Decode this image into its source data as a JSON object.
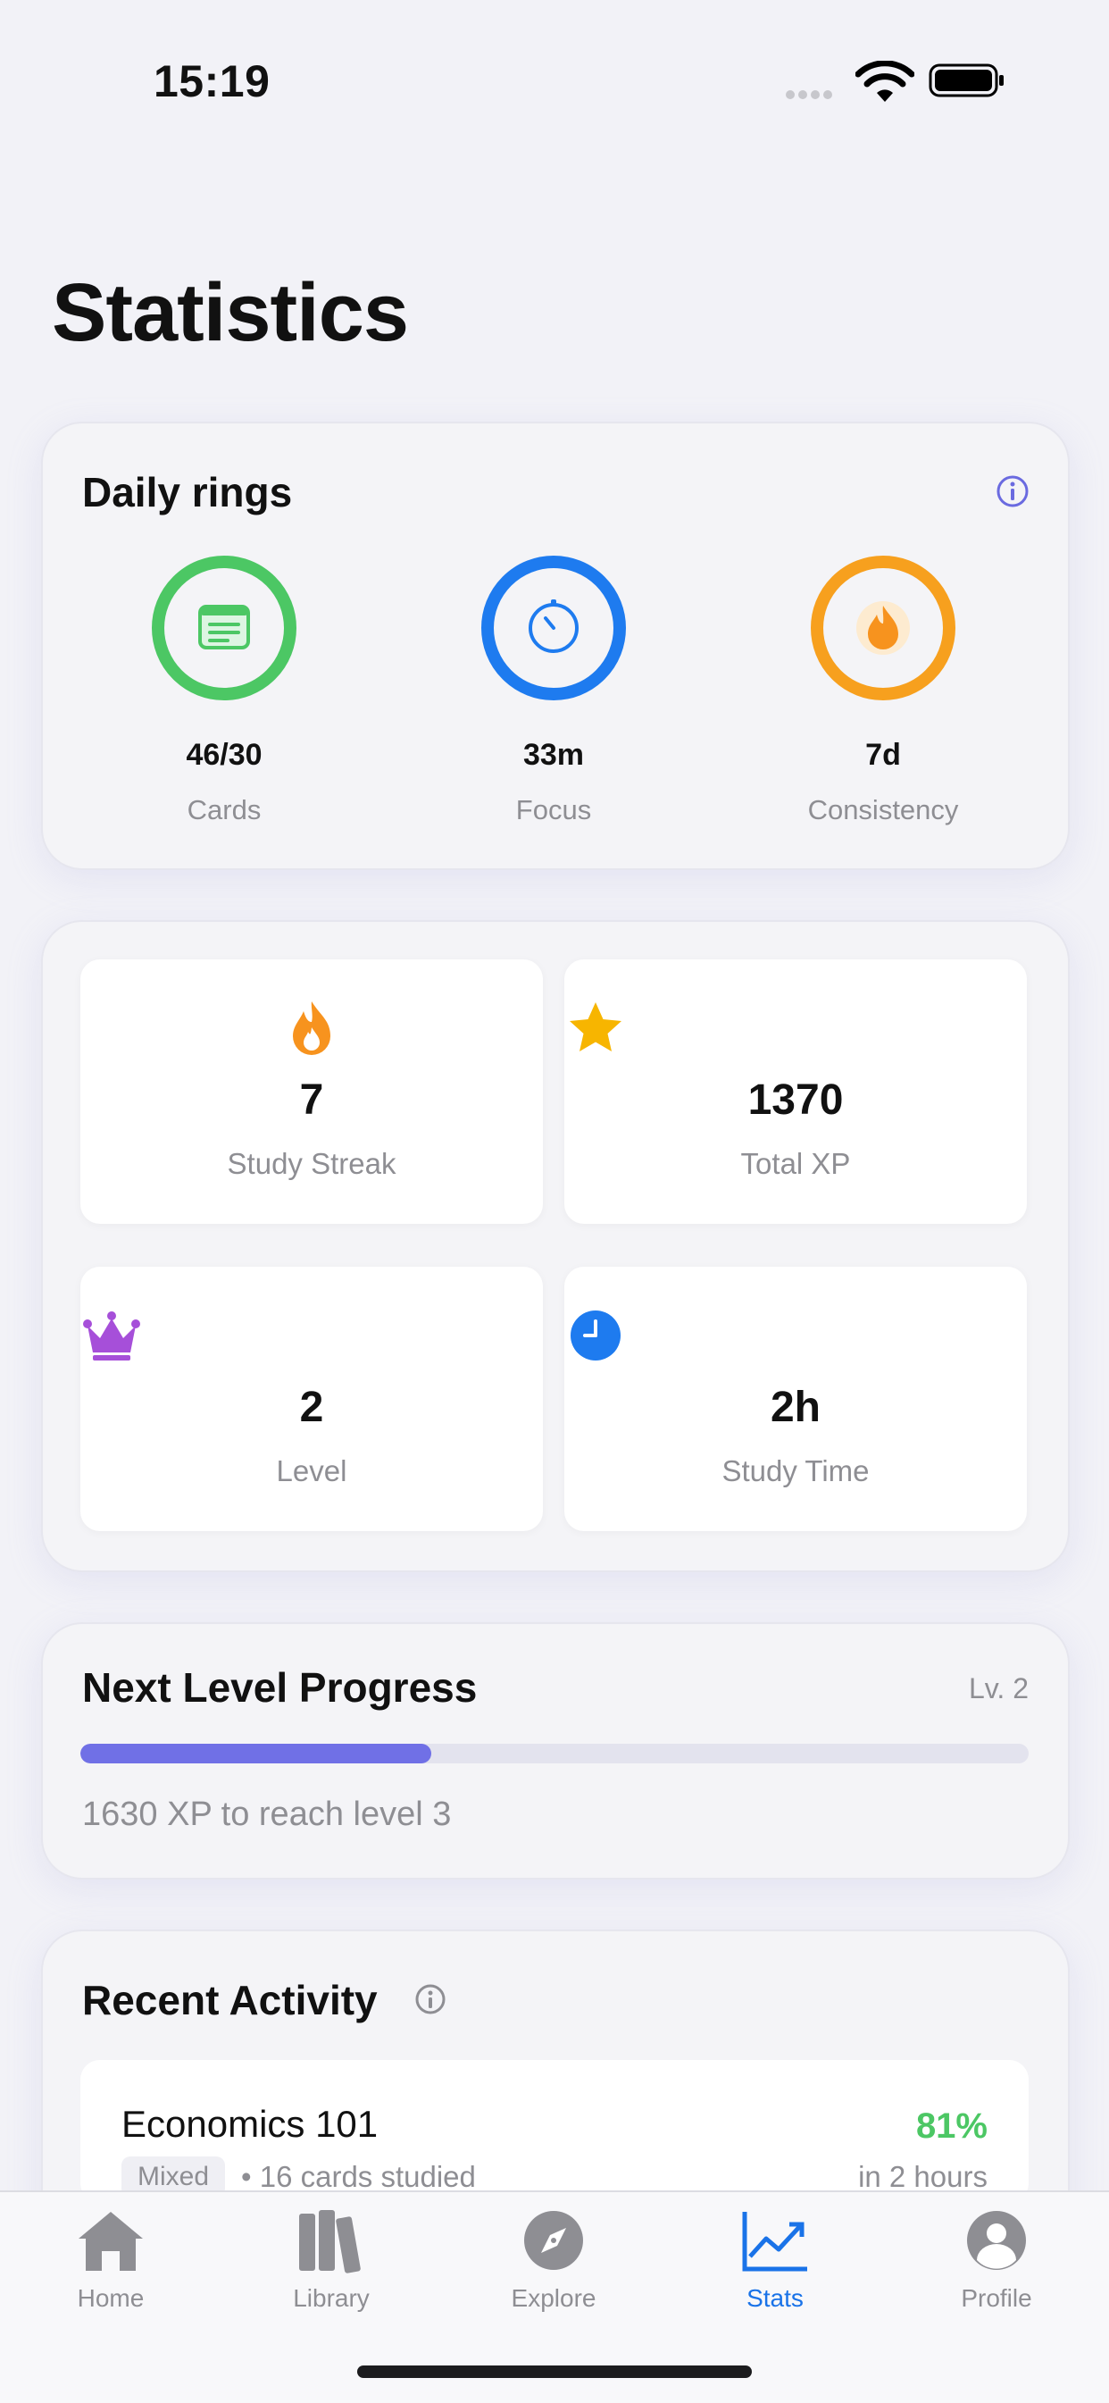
{
  "status_bar": {
    "time": "15:19"
  },
  "page_title": "Statistics",
  "daily_rings": {
    "title": "Daily rings",
    "rings": [
      {
        "value": "46/30",
        "label": "Cards",
        "color": "#4CC764",
        "icon": "card-icon",
        "progress": 1.0
      },
      {
        "value": "33m",
        "label": "Focus",
        "color": "#1E7BEF",
        "icon": "timer-icon",
        "progress": 1.0
      },
      {
        "value": "7d",
        "label": "Consistency",
        "color": "#F7A01E",
        "icon": "flame-icon",
        "progress": 1.0
      }
    ]
  },
  "stats": [
    {
      "value": "7",
      "label": "Study Streak",
      "icon": "flame-icon",
      "color": "#F7931E"
    },
    {
      "value": "1370",
      "label": "Total XP",
      "icon": "star-icon",
      "color": "#F7B500"
    },
    {
      "value": "2",
      "label": "Level",
      "icon": "crown-icon",
      "color": "#A64FD9"
    },
    {
      "value": "2h",
      "label": "Study Time",
      "icon": "clock-icon",
      "color": "#1E7BEF"
    }
  ],
  "next_level": {
    "title": "Next Level Progress",
    "level_badge": "Lv. 2",
    "progress": 0.37,
    "caption": "1630 XP to reach level 3",
    "color": "#7070E6"
  },
  "recent_activity": {
    "title": "Recent Activity",
    "items": [
      {
        "name": "Economics 101",
        "tag": "Mixed",
        "detail": "• 16 cards studied",
        "score": "81%",
        "time": "in 2 hours"
      }
    ]
  },
  "tabbar": {
    "tabs": [
      {
        "label": "Home",
        "icon": "house-icon"
      },
      {
        "label": "Library",
        "icon": "books-icon"
      },
      {
        "label": "Explore",
        "icon": "compass-icon"
      },
      {
        "label": "Stats",
        "icon": "chart-icon",
        "active": true
      },
      {
        "label": "Profile",
        "icon": "person-icon"
      }
    ]
  }
}
